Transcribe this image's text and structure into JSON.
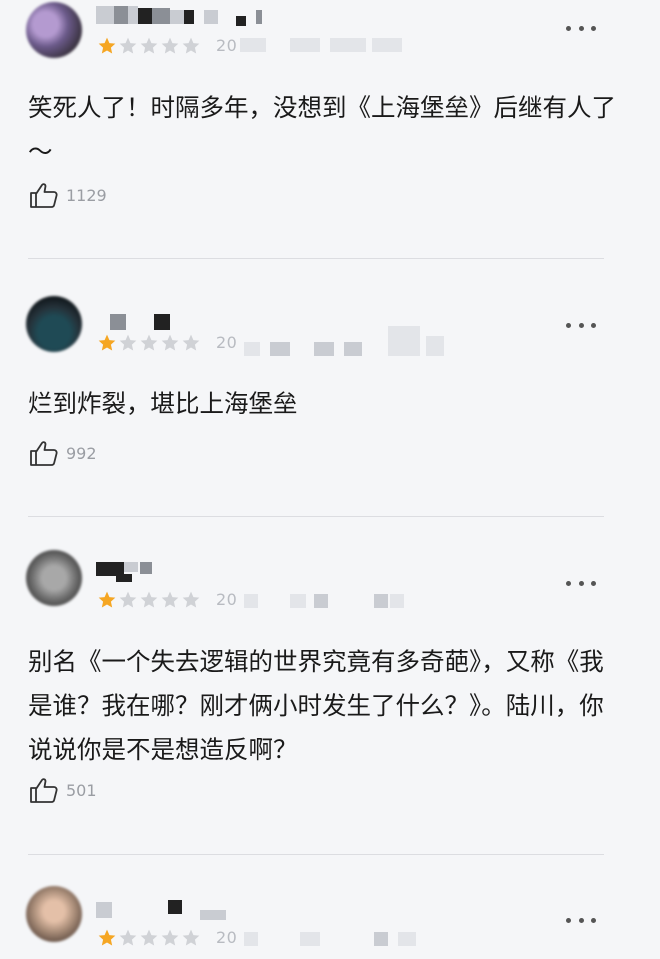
{
  "colors": {
    "star_filled": "#f5a623",
    "star_empty": "#d0d2d6",
    "background": "#f5f6f8"
  },
  "icons": {
    "more": "more-dots-icon",
    "like": "thumbs-up-icon",
    "star": "star-icon"
  },
  "comments": [
    {
      "rating": 1,
      "date": "20",
      "text": "笑死人了！时隔多年，没想到《上海堡垒》后继有人了～",
      "likes": "1129"
    },
    {
      "rating": 1,
      "date": "20",
      "text": "烂到炸裂，堪比上海堡垒",
      "likes": "992"
    },
    {
      "rating": 1,
      "date": "20",
      "text": "别名《一个失去逻辑的世界究竟有多奇葩》，又称《我是谁？我在哪？刚才俩小时发生了什么？》。陆川，你说说你是不是想造反啊？",
      "likes": "501"
    },
    {
      "rating": 1,
      "date": "20"
    }
  ]
}
